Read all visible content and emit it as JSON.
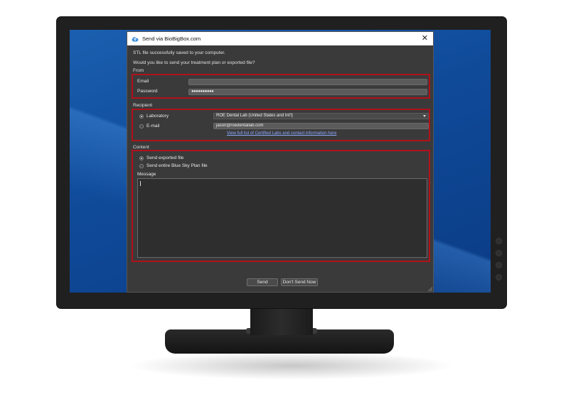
{
  "dialog": {
    "title": "Send via BioBigBox.com",
    "close_glyph": "✕",
    "intro_line1": "STL file successfully saved to your computer.",
    "intro_line2": "Would you like to send your treatment plan or exported file?"
  },
  "from": {
    "section_label": "From",
    "email_label": "Email",
    "email_value": "",
    "password_label": "Password",
    "password_value": "●●●●●●●●●●"
  },
  "recipient": {
    "section_label": "Recipient",
    "laboratory_label": "Laboratory",
    "laboratory_selected": "ROE Dental Lab (United States and Int'l)",
    "email_label": "E-mail",
    "email_value": "jason@roedentallab.com",
    "certified_link": "View full list of Certified Labs and contact information here"
  },
  "content": {
    "section_label": "Content",
    "option_exported": "Send exported file",
    "option_plan": "Send entire Blue Sky Plan file",
    "message_label": "Message",
    "message_value": ""
  },
  "buttons": {
    "send": "Send",
    "dont_send": "Don't Send Now"
  },
  "colors": {
    "highlight_border": "#b0121b",
    "dialog_bg": "#3a3a3a",
    "link": "#8ea8ff",
    "desktop": "#0f4a99"
  },
  "icons": {
    "app": "cloud-upload-icon",
    "close": "close-icon",
    "dropdown": "chevron-down-icon",
    "resize": "resize-grip-icon"
  }
}
